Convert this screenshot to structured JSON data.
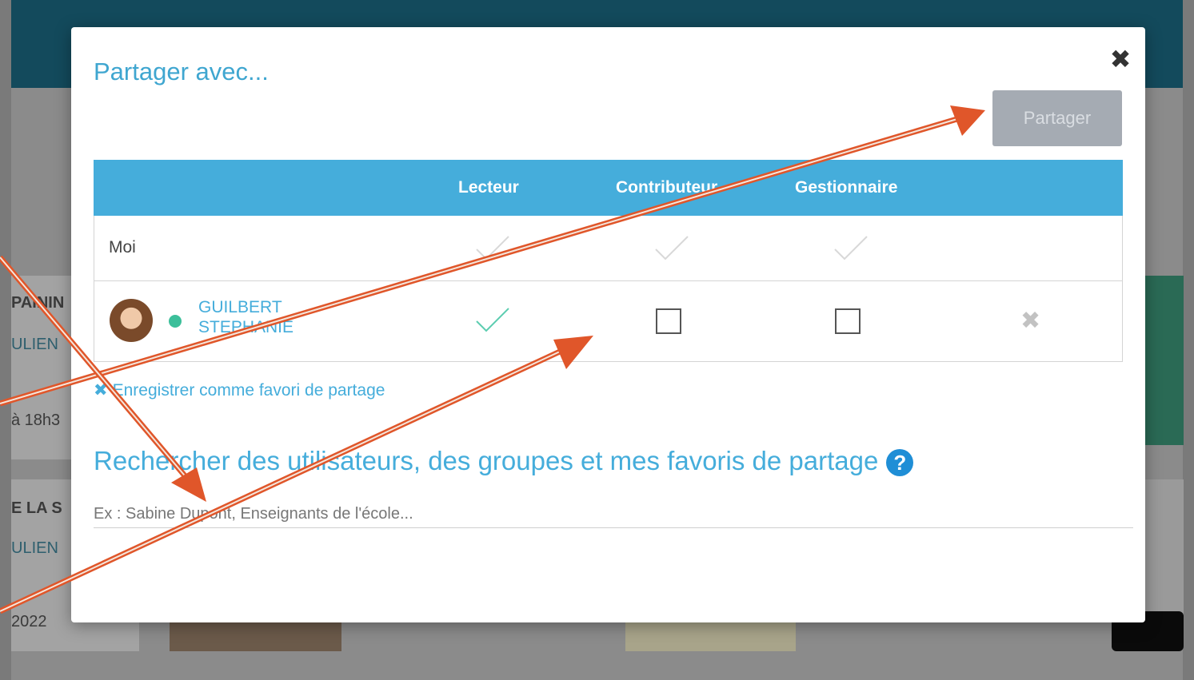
{
  "background": {
    "cards": [
      {
        "title": "PAININ",
        "author": "ULIEN",
        "meta": "à 18h3"
      },
      {
        "title": "E LA S",
        "author": "ULIEN",
        "meta": "2022"
      }
    ]
  },
  "modal": {
    "title": "Partager avec...",
    "share_button": "Partager",
    "columns": [
      "Lecteur",
      "Contributeur",
      "Gestionnaire"
    ],
    "me_row": {
      "label": "Moi"
    },
    "user_row": {
      "name_line1": "GUILBERT",
      "name_line2": "STEPHANIE",
      "status": "online",
      "lecteur": true,
      "contributeur": false,
      "gestionnaire": false
    },
    "save_favorite_link": "Enregistrer comme favori de partage",
    "search_title": "Rechercher des utilisateurs, des groupes et mes favoris de partage",
    "search_placeholder": "Ex : Sabine Dupont, Enseignants de l'école..."
  },
  "colors": {
    "accent": "#45addb",
    "header_bar": "#45addb",
    "button_disabled": "#a5abb3",
    "online_dot": "#3cbf9a",
    "annotation_arrow": "#e0562a"
  }
}
